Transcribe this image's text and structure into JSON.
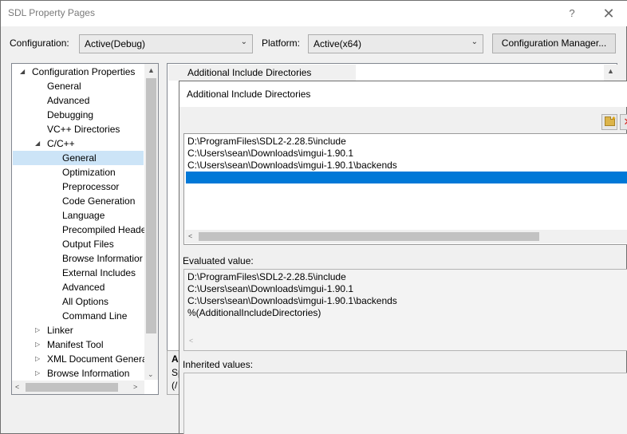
{
  "window": {
    "title": "SDL Property Pages",
    "help_glyph": "?",
    "close_glyph": "✕"
  },
  "toolbar": {
    "configuration_label": "Configuration:",
    "configuration_value": "Active(Debug)",
    "platform_label": "Platform:",
    "platform_value": "Active(x64)",
    "config_manager_label": "Configuration Manager..."
  },
  "tree": {
    "items": [
      {
        "label": "Configuration Properties",
        "level": 0,
        "expanded": true
      },
      {
        "label": "General",
        "level": 1
      },
      {
        "label": "Advanced",
        "level": 1
      },
      {
        "label": "Debugging",
        "level": 1
      },
      {
        "label": "VC++ Directories",
        "level": 1
      },
      {
        "label": "C/C++",
        "level": 1,
        "expanded": true
      },
      {
        "label": "General",
        "level": 2,
        "selected": true
      },
      {
        "label": "Optimization",
        "level": 2
      },
      {
        "label": "Preprocessor",
        "level": 2
      },
      {
        "label": "Code Generation",
        "level": 2
      },
      {
        "label": "Language",
        "level": 2
      },
      {
        "label": "Precompiled Heade",
        "level": 2
      },
      {
        "label": "Output Files",
        "level": 2
      },
      {
        "label": "Browse Informatior",
        "level": 2
      },
      {
        "label": "External Includes",
        "level": 2
      },
      {
        "label": "Advanced",
        "level": 2
      },
      {
        "label": "All Options",
        "level": 2
      },
      {
        "label": "Command Line",
        "level": 2
      },
      {
        "label": "Linker",
        "level": 1,
        "collapsed": true
      },
      {
        "label": "Manifest Tool",
        "level": 1,
        "collapsed": true
      },
      {
        "label": "XML Document Genera",
        "level": 1,
        "collapsed": true
      },
      {
        "label": "Browse Information",
        "level": 1,
        "collapsed": true
      }
    ]
  },
  "grid": {
    "header": "Additional Include Directories",
    "desc_prefix": "Ad",
    "desc_line2": "Sp",
    "desc_line3": "(/"
  },
  "dialog": {
    "title": "Additional Include Directories",
    "directories": [
      "D:\\ProgramFiles\\SDL2-2.28.5\\include",
      "C:\\Users\\sean\\Downloads\\imgui-1.90.1",
      "C:\\Users\\sean\\Downloads\\imgui-1.90.1\\backends"
    ],
    "evaluated_label": "Evaluated value:",
    "evaluated": [
      "D:\\ProgramFiles\\SDL2-2.28.5\\include",
      "C:\\Users\\sean\\Downloads\\imgui-1.90.1",
      "C:\\Users\\sean\\Downloads\\imgui-1.90.1\\backends",
      "%(AdditionalIncludeDirectories)"
    ],
    "inherited_label": "Inherited values:"
  },
  "icons": {
    "new_line": "folder-new-icon",
    "delete": "delete-icon"
  },
  "colors": {
    "selection": "#0078d7",
    "tree_selection": "#cce4f7"
  }
}
